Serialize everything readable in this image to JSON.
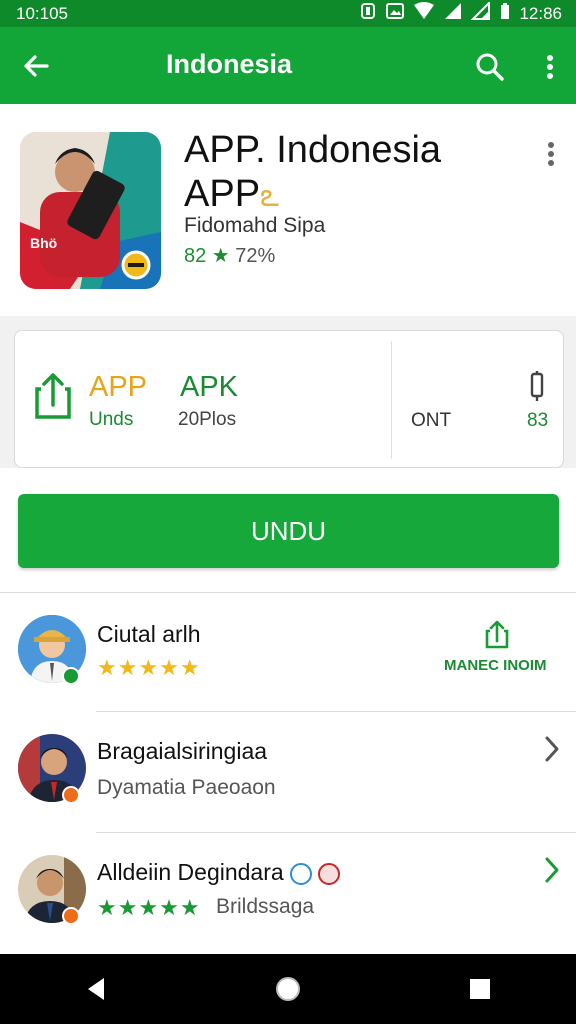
{
  "status_bar": {
    "time_left": "10:105",
    "time_right": "12:86"
  },
  "app_bar": {
    "title": "Indonesia",
    "icons": [
      "back-arrow-icon",
      "search-icon",
      "overflow-menu-icon"
    ]
  },
  "app_header": {
    "title_line1": "APP. Indonesia",
    "title_line2": "APP",
    "title_emoji": "ఽ",
    "developer": "Fidomahd Sipa",
    "rating_prefix": "82 ★",
    "rating_pct": "72%"
  },
  "info_card": {
    "app_label": "APP",
    "app_sub": "Unds",
    "apk_label": "APK",
    "apk_sub": "20Plos",
    "ont_label": "ONT",
    "num_label": "83"
  },
  "install_button": {
    "label": "UNDU"
  },
  "list": [
    {
      "title": "Ciutal arlh",
      "stars": "★★★★★",
      "action": "MANEC INOIM"
    },
    {
      "title": "Bragaialsiringiaa",
      "subtitle": "Dyamatia Paeoaon"
    },
    {
      "title": "Alldeiin Degindara",
      "stars": "★★★★★",
      "subtitle": "Brildssaga"
    }
  ],
  "colors": {
    "primary": "#12a537",
    "status": "#0f8a2a",
    "accent": "#e6a419",
    "star_yellow": "#f2b818",
    "star_green": "#1a9a34"
  }
}
